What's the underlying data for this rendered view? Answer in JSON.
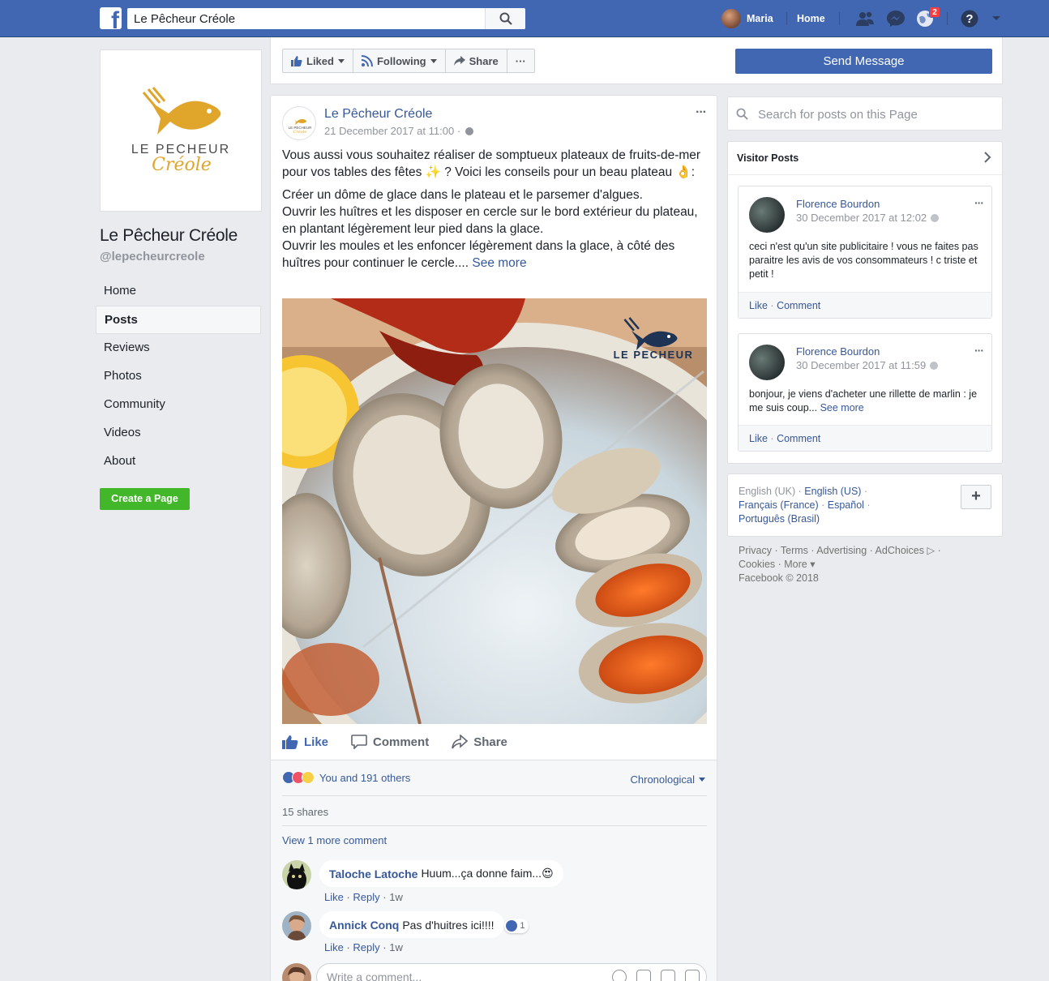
{
  "topbar": {
    "logo_letter": "f",
    "search_value": "Le Pêcheur Créole",
    "user_name": "Maria",
    "home_label": "Home",
    "notif_count": "2",
    "icons": [
      "friends-icon",
      "messenger-icon",
      "notifications-icon",
      "help-icon",
      "menu-caret-icon"
    ],
    "brand_color": "#4267b2"
  },
  "page": {
    "logo_text_top": "LE PECHEUR",
    "logo_text_bottom": "Créole",
    "name": "Le Pêcheur Créole",
    "handle": "@lepecheurcreole",
    "nav": [
      "Home",
      "Posts",
      "Reviews",
      "Photos",
      "Community",
      "Videos",
      "About"
    ],
    "active_nav": "Posts",
    "create_page_label": "Create a Page"
  },
  "actions": {
    "liked": "Liked",
    "following": "Following",
    "share": "Share",
    "more": "···",
    "send_message": "Send Message"
  },
  "post": {
    "author": "Le Pêcheur Créole",
    "timestamp": "21 December 2017 at 11:00 ·",
    "avatar_text_top": "LE PECHEUR",
    "avatar_text_bottom": "Créole",
    "dots": "···",
    "para1": "Vous aussi vous souhaitez réaliser de somptueux plateaux de fruits-de-mer pour vos tables des fêtes ✨ ? Voici les conseils pour un beau plateau 👌:",
    "para2_line1": "Créer un dôme de glace dans le plateau et le parsemer d'algues.",
    "para2_line2": "Ouvrir les huîtres et les disposer en cercle sur le bord extérieur du plateau, en plantant légèrement leur pied dans la glace.",
    "para2_line3": "Ouvrir les moules et les enfoncer légèrement dans la glace, à côté des huîtres pour continuer le cercle....",
    "see_more": "See more",
    "image_logo_text": "LE PECHEUR",
    "like": "Like",
    "comment": "Comment",
    "share": "Share",
    "reactions_text": "You and 191 others",
    "sort": "Chronological",
    "shares": "15 shares",
    "view_more": "View 1 more comment",
    "comments": [
      {
        "name": "Taloche Latoche",
        "text": "Huum...ça donne faim...😍",
        "like": "Like",
        "reply": "Reply",
        "age": "1w"
      },
      {
        "name": "Annick Conq",
        "text": "Pas d'huitres ici!!!!",
        "like": "Like",
        "reply": "Reply",
        "age": "1w",
        "likes": "1"
      }
    ],
    "write_placeholder": "Write a comment..."
  },
  "right": {
    "search_placeholder": "Search for posts on this Page",
    "visitor_title": "Visitor Posts",
    "visitor_posts": [
      {
        "name": "Florence Bourdon",
        "time": "30 December 2017 at 12:02",
        "text": "ceci n'est qu'un site publicitaire ! vous ne faites pas paraitre les avis de vos consommateurs ! c triste et petit !",
        "like": "Like",
        "comment": "Comment"
      },
      {
        "name": "Florence Bourdon",
        "time": "30 December 2017 at 11:59",
        "text": "bonjour, je viens d'acheter une rillette de marlin : je me suis coup...",
        "see_more": "See more",
        "like": "Like",
        "comment": "Comment"
      }
    ],
    "languages": {
      "current": "English (UK)",
      "l1": "English (US)",
      "l2": "Français (France)",
      "l3": "Español",
      "l4": "Português (Brasil)",
      "add": "+"
    },
    "footer": {
      "line1": "Privacy · Terms · Advertising · AdChoices ▷ ·",
      "line2": "Cookies · More ▾",
      "line3": "Facebook © 2018"
    }
  }
}
